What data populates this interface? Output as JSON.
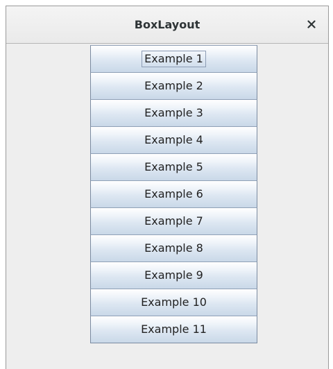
{
  "window": {
    "title": "BoxLayout",
    "close_icon": "close-icon"
  },
  "buttons": [
    {
      "label": "Example 1",
      "focused": true
    },
    {
      "label": "Example 2",
      "focused": false
    },
    {
      "label": "Example 3",
      "focused": false
    },
    {
      "label": "Example 4",
      "focused": false
    },
    {
      "label": "Example 5",
      "focused": false
    },
    {
      "label": "Example 6",
      "focused": false
    },
    {
      "label": "Example 7",
      "focused": false
    },
    {
      "label": "Example 8",
      "focused": false
    },
    {
      "label": "Example 9",
      "focused": false
    },
    {
      "label": "Example 10",
      "focused": false
    },
    {
      "label": "Example 11",
      "focused": false
    }
  ]
}
